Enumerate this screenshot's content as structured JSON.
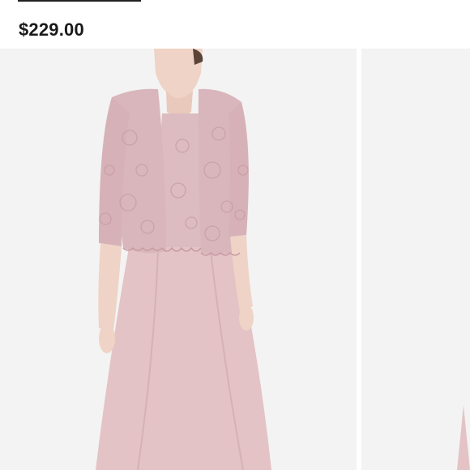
{
  "product": {
    "price": "$229.00"
  },
  "gallery": {
    "main_image": "model-in-blush-lace-jacket-dress",
    "next_image": "product-image-partial",
    "colors": {
      "background": "#f3f3f3",
      "lace": "#d9b7bd",
      "gown": "#e3c4c7",
      "skin": "#f2d6c9"
    }
  }
}
